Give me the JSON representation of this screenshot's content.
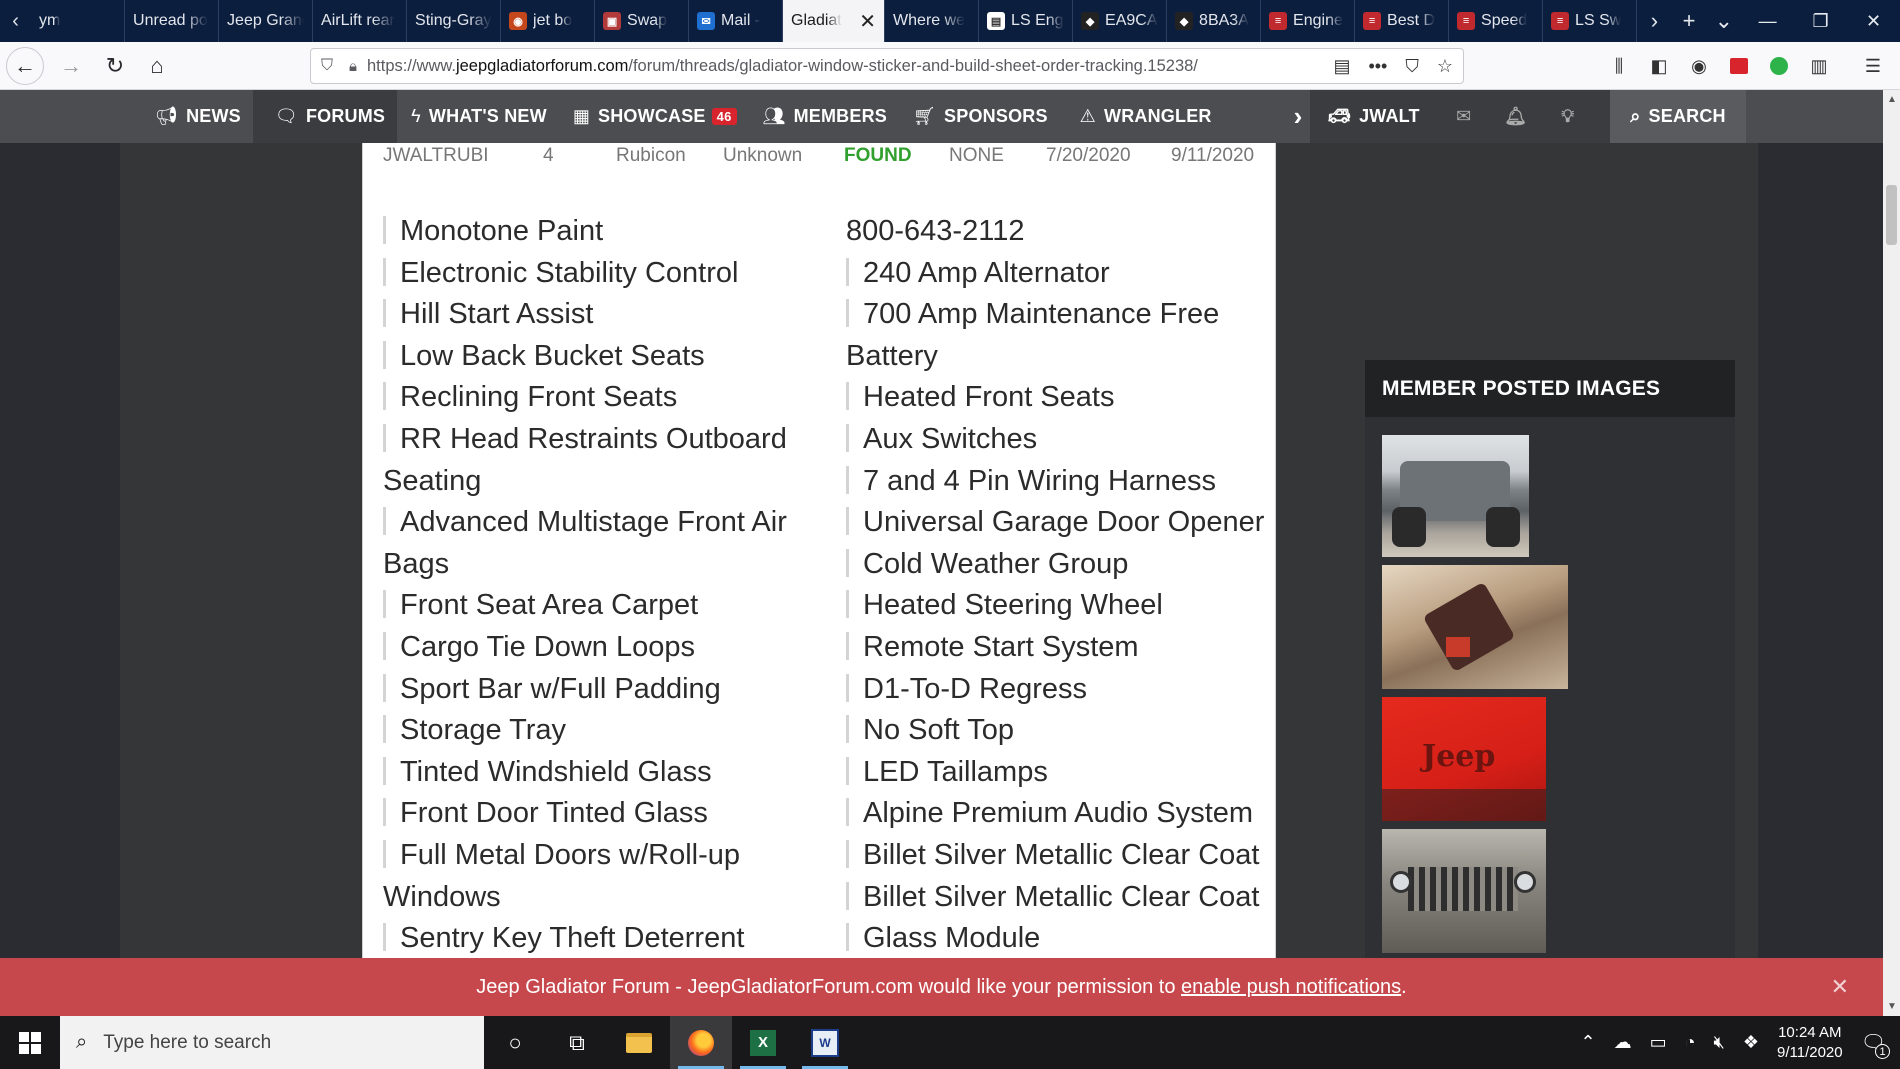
{
  "browser": {
    "tabs": [
      {
        "label": "ym",
        "fav": "",
        "color": "#1c4a8a"
      },
      {
        "label": "Unread po",
        "fav": "",
        "color": ""
      },
      {
        "label": "Jeep Granc",
        "fav": "",
        "color": ""
      },
      {
        "label": "AirLift rear",
        "fav": "",
        "color": ""
      },
      {
        "label": "Sting-Gray",
        "fav": "",
        "color": ""
      },
      {
        "label": "jet bo",
        "fav": "◉",
        "color": "#c4471c"
      },
      {
        "label": "Swap",
        "fav": "▣",
        "color": "#b23a3a"
      },
      {
        "label": "Mail -",
        "fav": "✉",
        "color": "#1f6fd1"
      },
      {
        "label": "Gladiat",
        "fav": "",
        "color": "",
        "active": true
      },
      {
        "label": "Where we",
        "fav": "",
        "color": ""
      },
      {
        "label": "LS Eng",
        "fav": "▤",
        "color": "#ffffff"
      },
      {
        "label": "EA9CA",
        "fav": "◆",
        "color": "#222222"
      },
      {
        "label": "8BA3A",
        "fav": "◆",
        "color": "#222222"
      },
      {
        "label": "Engine",
        "fav": "≡",
        "color": "#c0292e"
      },
      {
        "label": "Best D",
        "fav": "≡",
        "color": "#c0292e"
      },
      {
        "label": "Speed",
        "fav": "≡",
        "color": "#c0292e"
      },
      {
        "label": "LS Sw",
        "fav": "≡",
        "color": "#c0292e"
      }
    ],
    "url_prefix": "https://www.",
    "url_domain": "jeepgladiatorforum.com",
    "url_path": "/forum/threads/gladiator-window-sticker-and-build-sheet-order-tracking.15238/"
  },
  "site_nav": {
    "items": [
      {
        "label": "NEWS",
        "icon": "megaphone-icon"
      },
      {
        "label": "FORUMS",
        "icon": "comments-icon",
        "active": true
      },
      {
        "label": "WHAT'S NEW",
        "icon": "bolt-icon"
      },
      {
        "label": "SHOWCASE",
        "icon": "grid-icon",
        "badge": "46"
      },
      {
        "label": "MEMBERS",
        "icon": "users-icon"
      },
      {
        "label": "SPONSORS",
        "icon": "cart-icon"
      },
      {
        "label": "WRANGLER",
        "icon": "warning-icon"
      }
    ],
    "username": "JWALT",
    "search_label": "SEARCH"
  },
  "row": {
    "user": "JWALTRUBI",
    "door": "4",
    "trim": "Rubicon",
    "status1": "Unknown",
    "status2": "FOUND",
    "status3": "NONE",
    "date1": "7/20/2020",
    "date2": "9/11/2020"
  },
  "features": {
    "left": [
      {
        "text": "Monotone Paint",
        "bar": true
      },
      {
        "text": "Electronic Stability Control",
        "bar": true
      },
      {
        "text": "Hill Start Assist",
        "bar": true
      },
      {
        "text": "Low Back Bucket Seats",
        "bar": true
      },
      {
        "text": "Reclining Front Seats",
        "bar": true
      },
      {
        "text": "RR Head Restraints Outboard",
        "bar": true
      },
      {
        "text": "Seating",
        "bar": false
      },
      {
        "text": "Advanced Multistage Front Air",
        "bar": true
      },
      {
        "text": "Bags",
        "bar": false
      },
      {
        "text": "Front Seat Area Carpet",
        "bar": true
      },
      {
        "text": "Cargo Tie Down Loops",
        "bar": true
      },
      {
        "text": "Sport Bar w/Full Padding",
        "bar": true
      },
      {
        "text": "Storage Tray",
        "bar": true
      },
      {
        "text": "Tinted Windshield Glass",
        "bar": true
      },
      {
        "text": "Front Door Tinted Glass",
        "bar": true
      },
      {
        "text": "Full Metal Doors w/Roll-up",
        "bar": true
      },
      {
        "text": "Windows",
        "bar": false
      },
      {
        "text": "Sentry Key Theft Deterrent",
        "bar": true
      }
    ],
    "right": [
      {
        "text": "800-643-2112",
        "bar": false
      },
      {
        "text": "240 Amp Alternator",
        "bar": true
      },
      {
        "text": "700 Amp Maintenance Free",
        "bar": true
      },
      {
        "text": "Battery",
        "bar": false
      },
      {
        "text": "Heated Front Seats",
        "bar": true
      },
      {
        "text": "Aux Switches",
        "bar": true
      },
      {
        "text": "7 and 4 Pin Wiring Harness",
        "bar": true
      },
      {
        "text": "Universal Garage Door Opener",
        "bar": true
      },
      {
        "text": "Cold Weather Group",
        "bar": true
      },
      {
        "text": "Heated Steering Wheel",
        "bar": true
      },
      {
        "text": "Remote Start System",
        "bar": true
      },
      {
        "text": "D1-To-D Regress",
        "bar": true
      },
      {
        "text": "No Soft Top",
        "bar": true
      },
      {
        "text": "LED Taillamps",
        "bar": true
      },
      {
        "text": "Alpine Premium Audio System",
        "bar": true
      },
      {
        "text": "Billet Silver Metallic Clear Coat",
        "bar": true
      },
      {
        "text": "Billet Silver Metallic Clear Coat",
        "bar": true
      },
      {
        "text": "Glass Module",
        "bar": true
      }
    ]
  },
  "sidebar": {
    "heading": "MEMBER POSTED IMAGES"
  },
  "notification": {
    "text": "Jeep Gladiator Forum - JeepGladiatorForum.com would like your permission to",
    "link": "enable push notifications",
    "end": "."
  },
  "taskbar": {
    "search_placeholder": "Type here to search",
    "time": "10:24 AM",
    "date": "9/11/2020",
    "notification_count": "1"
  },
  "colors": {
    "accent_found": "#31a02e",
    "notification_bg": "#c7484c",
    "badge_red": "#d8242d"
  }
}
